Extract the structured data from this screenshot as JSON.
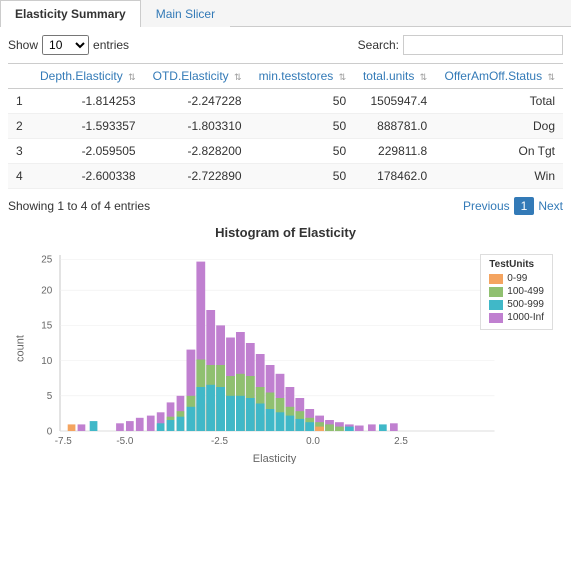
{
  "tabs": [
    {
      "label": "Elasticity Summary",
      "active": true
    },
    {
      "label": "Main Slicer",
      "active": false
    }
  ],
  "controls": {
    "show_label": "Show",
    "entries_label": "entries",
    "show_value": "10",
    "show_options": [
      "10",
      "25",
      "50",
      "100"
    ],
    "search_label": "Search:",
    "search_value": ""
  },
  "table": {
    "columns": [
      {
        "label": "Depth.Elasticity",
        "key": "depth"
      },
      {
        "label": "OTD.Elasticity",
        "key": "otd"
      },
      {
        "label": "min.teststores",
        "key": "min"
      },
      {
        "label": "total.units",
        "key": "total"
      },
      {
        "label": "OfferAmOff.Status",
        "key": "status"
      }
    ],
    "rows": [
      {
        "id": 1,
        "depth": "-1.814253",
        "otd": "-2.247228",
        "min": "50",
        "total": "1505947.4",
        "status": "Total"
      },
      {
        "id": 2,
        "depth": "-1.593357",
        "otd": "-1.803310",
        "min": "50",
        "total": "888781.0",
        "status": "Dog"
      },
      {
        "id": 3,
        "depth": "-2.059505",
        "otd": "-2.828200",
        "min": "50",
        "total": "229811.8",
        "status": "On Tgt"
      },
      {
        "id": 4,
        "depth": "-2.600338",
        "otd": "-2.722890",
        "min": "50",
        "total": "178462.0",
        "status": "Win"
      }
    ]
  },
  "footer": {
    "showing_text": "Showing 1 to 4 of 4 entries",
    "previous_label": "Previous",
    "next_label": "Next",
    "current_page": "1"
  },
  "chart": {
    "title": "Histogram of Elasticity",
    "x_label": "Elasticity",
    "y_label": "count",
    "legend": {
      "title": "TestUnits",
      "items": [
        {
          "label": "0-99",
          "color": "#f4a460"
        },
        {
          "label": "100-499",
          "color": "#90c070"
        },
        {
          "label": "500-999",
          "color": "#40b8c8"
        },
        {
          "label": "1000-Inf",
          "color": "#c080d0"
        }
      ]
    },
    "colors": {
      "c0_99": "#f4a460",
      "c100_499": "#90c070",
      "c500_999": "#40b8c8",
      "c1000_inf": "#c080d0"
    }
  }
}
